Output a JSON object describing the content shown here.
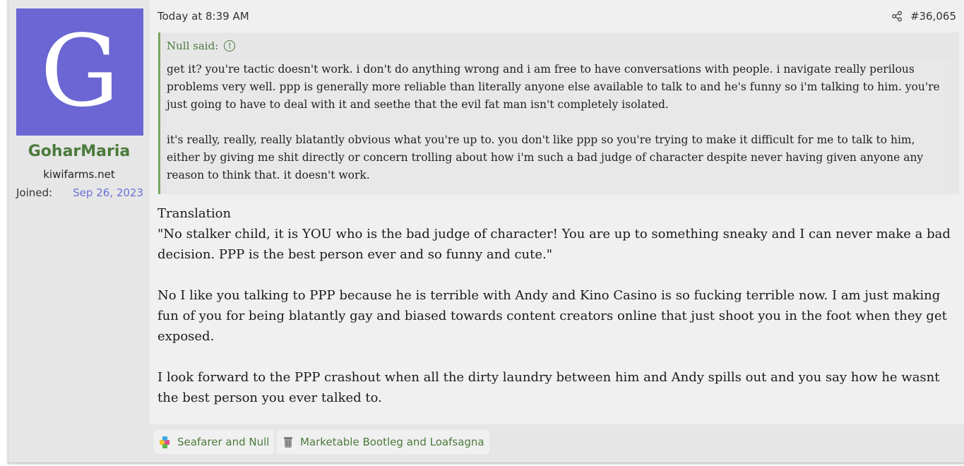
{
  "user": {
    "avatar_letter": "G",
    "avatar_color": "#6b66d4",
    "username": "GoharMaria",
    "title": "kiwifarms.net",
    "joined_label": "Joined:",
    "joined_date": "Sep 26, 2023"
  },
  "meta": {
    "date": "Today at 8:39 AM",
    "share_icon": "share-icon",
    "post_number": "#36,065"
  },
  "quote": {
    "author": "Null said:",
    "jump_icon": "arrow-up-circle-icon",
    "paragraphs": [
      "get it? you're tactic doesn't work. i don't do anything wrong and i am free to have conversations with people. i navigate really perilous problems very well. ppp is generally more reliable than literally anyone else available to talk to and he's funny so i'm talking to him. you're just going to have to deal with it and seethe that the evil fat man isn't completely isolated.",
      "it's really, really, really blatantly obvious what you're up to. you don't like ppp so you're trying to make it difficult for me to talk to him, either by giving me shit directly or concern trolling about how i'm such a bad judge of character despite never having given anyone any reason to think that. it doesn't work."
    ]
  },
  "body": {
    "p1_line1": "Translation",
    "p1_line2": "\"No stalker child, it is YOU who is the bad judge of character! You are up to something sneaky and I can never make a bad decision. PPP is the best person ever and so funny and cute.\"",
    "p2": "No I like you talking to PPP because he is terrible with Andy and Kino Casino is so fucking terrible now. I am just making fun of you for being blatantly gay and biased towards content creators online that just shoot you in the foot when they get exposed.",
    "p3": "I look forward to the PPP crashout when all the dirty laundry between him and Andy spills out and you say how he wasnt the best person you ever talked to."
  },
  "reactions": [
    {
      "icon": "puzzle-icon",
      "label": "Seafarer and Null"
    },
    {
      "icon": "trash-can-icon",
      "label": "Marketable Bootleg and Loafsagna"
    }
  ],
  "colors": {
    "username": "#4b7a3b",
    "quote_border": "#78a561",
    "joined_date": "#6b6fd9",
    "post_bg": "#f0f0f0",
    "sidebar_bg": "#e6e6e6"
  }
}
